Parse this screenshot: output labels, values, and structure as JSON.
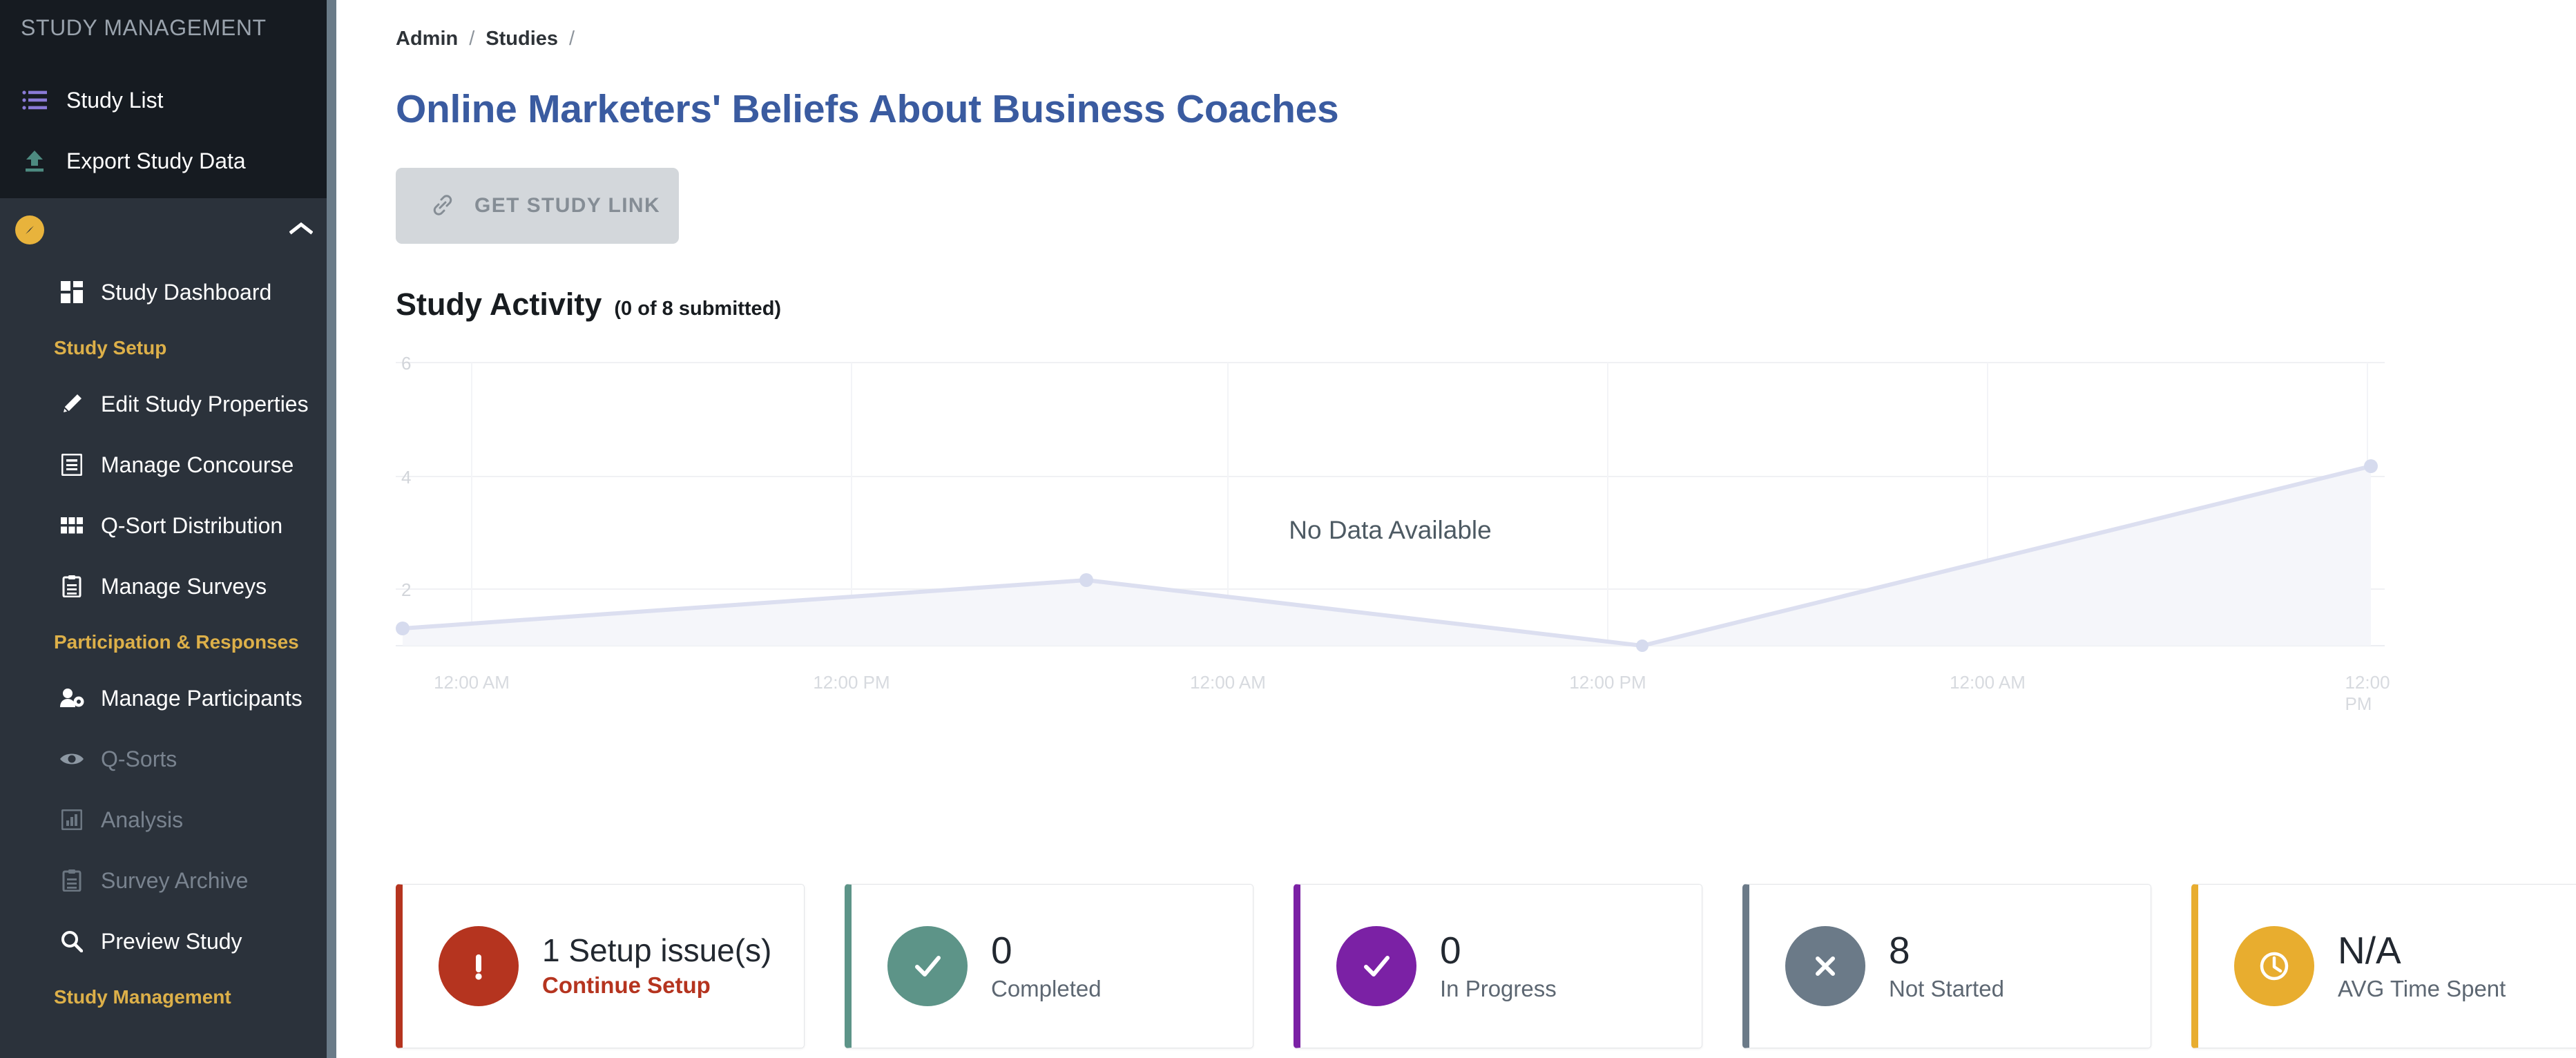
{
  "sidebar": {
    "title": "STUDY MANAGEMENT",
    "top_items": [
      {
        "label": "Study List",
        "icon": "list-icon"
      },
      {
        "label": "Export Study Data",
        "icon": "upload-icon"
      }
    ],
    "study_section": {
      "icon": "compass-icon",
      "collapse_icon": "chevron-up-icon"
    },
    "items": [
      {
        "label": "Study Dashboard",
        "icon": "dashboard-grid-icon",
        "dim": false
      },
      {
        "label": "Edit Study Properties",
        "icon": "pencil-icon",
        "dim": false
      },
      {
        "label": "Manage Concourse",
        "icon": "document-list-icon",
        "dim": false
      },
      {
        "label": "Q-Sort Distribution",
        "icon": "grid-icon",
        "dim": false
      },
      {
        "label": "Manage Surveys",
        "icon": "clipboard-icon",
        "dim": false
      },
      {
        "label": "Manage Participants",
        "icon": "user-gear-icon",
        "dim": false
      },
      {
        "label": "Q-Sorts",
        "icon": "eye-icon",
        "dim": true
      },
      {
        "label": "Analysis",
        "icon": "bar-chart-icon",
        "dim": true
      },
      {
        "label": "Survey Archive",
        "icon": "clipboard-icon",
        "dim": true
      },
      {
        "label": "Preview Study",
        "icon": "search-icon",
        "dim": false
      }
    ],
    "groups": {
      "study_setup": "Study Setup",
      "participation": "Participation & Responses",
      "study_management": "Study Management"
    },
    "colors": {
      "bg": "#2b323b",
      "top_bg": "#161b21",
      "group": "#ddb049",
      "accent": "#e8b33c"
    }
  },
  "breadcrumb": {
    "items": [
      "Admin",
      "Studies"
    ],
    "separator": "/"
  },
  "page": {
    "title": "Online Marketers' Beliefs About Business Coaches",
    "title_color": "#3a5ba0"
  },
  "toolbar": {
    "get_study_link_label": "GET STUDY LINK",
    "get_study_link_icon": "link-icon"
  },
  "activity": {
    "heading": "Study Activity",
    "submitted_note": "(0 of 8 submitted)",
    "empty_message": "No Data Available"
  },
  "chart_data": {
    "type": "area",
    "title": "Study Activity",
    "xlabel": "",
    "ylabel": "",
    "x_tick_labels": [
      "12:00 AM",
      "12:00 PM",
      "12:00 AM",
      "12:00 PM",
      "12:00 AM",
      "12:00 PM"
    ],
    "y_tick_labels": [
      "6",
      "4",
      "2"
    ],
    "yticks": [
      6,
      4,
      2
    ],
    "ylim": [
      0,
      7
    ],
    "grid": true,
    "legend": "none",
    "annotation": "No Data Available",
    "series": [
      {
        "name": "Activity",
        "x": [
          "12:00 AM",
          "12:00 PM",
          "12:00 AM",
          "12:00 PM",
          "12:00 AM",
          "12:00 PM"
        ],
        "points": [
          {
            "x_index": 0.0,
            "value": 1.3
          },
          {
            "x_index": 1.8,
            "value": 2.0
          },
          {
            "x_index": 3.55,
            "value": 0.0
          },
          {
            "x_index": 5.35,
            "value": 4.3
          }
        ],
        "line_color": "#d7dbef",
        "fill_color": "#f5f6fa"
      }
    ]
  },
  "cards": [
    {
      "value": "1 Setup issue(s)",
      "label": "Continue Setup",
      "label_is_link": true,
      "icon": "exclamation-icon",
      "accent": "#b5341f"
    },
    {
      "value": "0",
      "label": "Completed",
      "label_is_link": false,
      "icon": "check-icon",
      "accent": "#5d9488"
    },
    {
      "value": "0",
      "label": "In Progress",
      "label_is_link": false,
      "icon": "check-icon",
      "accent": "#7b21a5"
    },
    {
      "value": "8",
      "label": "Not Started",
      "label_is_link": false,
      "icon": "close-x-icon",
      "accent": "#6b7a88"
    },
    {
      "value": "N/A",
      "label": "AVG Time Spent",
      "label_is_link": false,
      "icon": "clock-icon",
      "accent": "#e8ad2f"
    }
  ]
}
